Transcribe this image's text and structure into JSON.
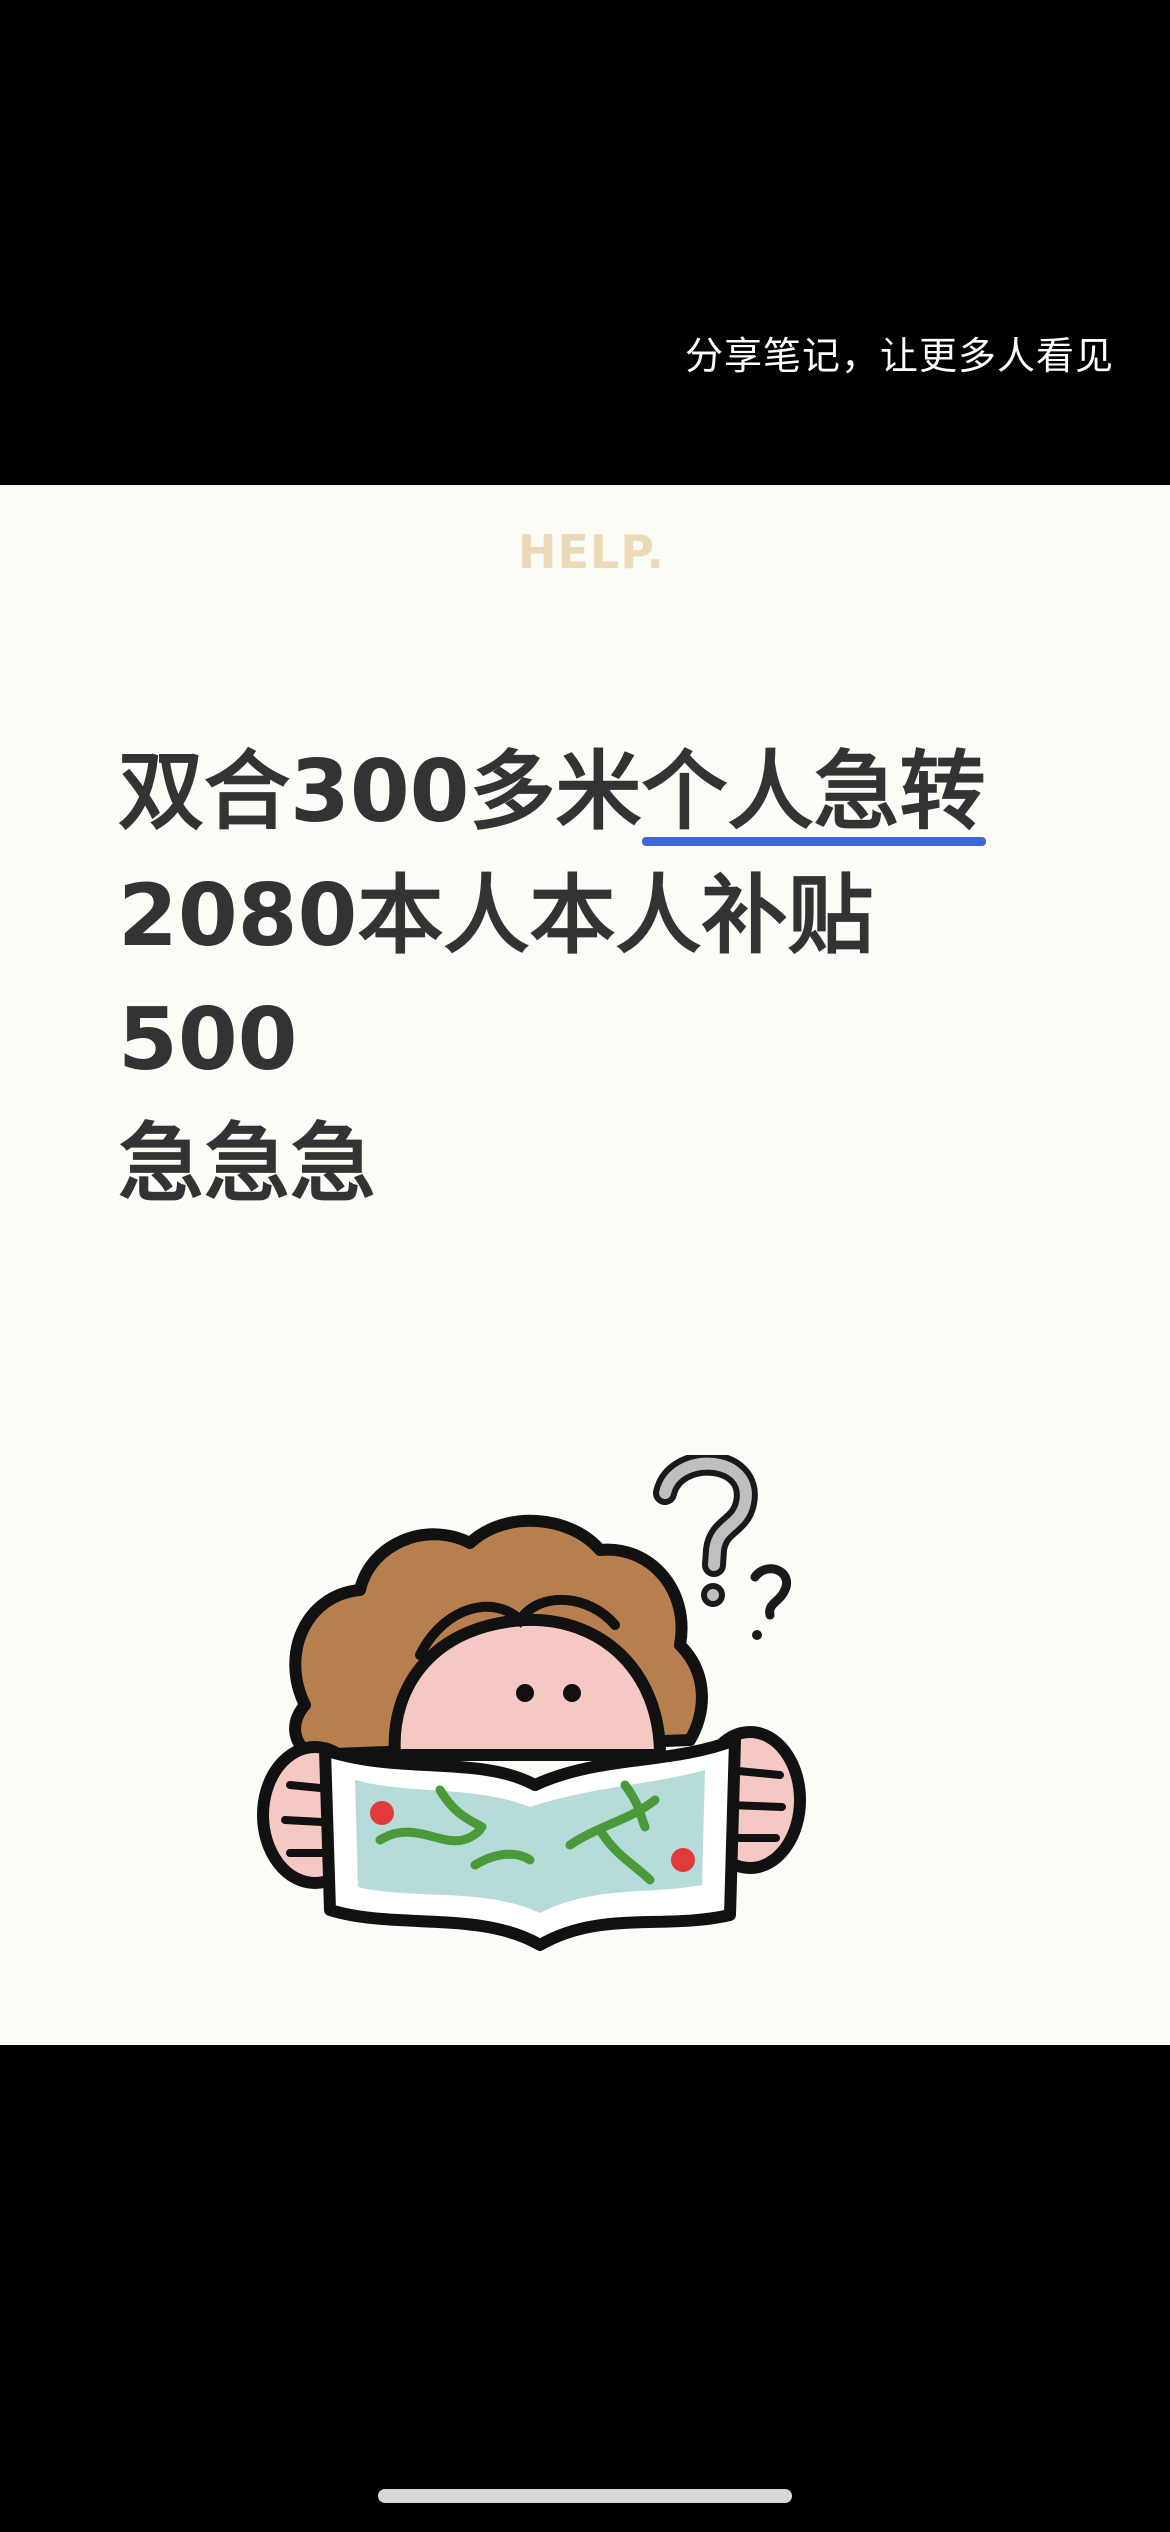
{
  "share_hint": "分享笔记，让更多人看见",
  "card": {
    "logo_text": "HELP.",
    "lines": [
      {
        "plain": "双合300多米",
        "highlight": "个人急转"
      },
      {
        "plain": "2080本人本人补贴"
      },
      {
        "plain": "500"
      },
      {
        "plain": "急急急"
      }
    ]
  },
  "illustration": {
    "icon": "girl-reading-map-icon",
    "question_mark": "?"
  },
  "colors": {
    "background": "#000000",
    "card_bg": "#fcfcf6",
    "text": "#333333",
    "underline": "#3e67d8",
    "hair": "#b87f4e",
    "map": "#b6dcd9"
  }
}
